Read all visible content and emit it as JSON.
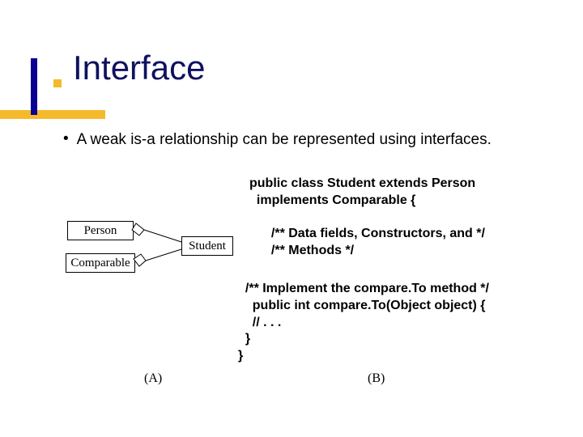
{
  "title": "Interface",
  "bullet": "A weak is-a relationship can be represented using interfaces.",
  "code_top": "public class Student extends Person\n  implements Comparable {",
  "code_mid": "  /** Data fields, Constructors, and */\n  /** Methods */",
  "code_bot": "  /** Implement the compare.To method */\n    public int compare.To(Object object) {\n    // . . .\n  }\n}",
  "uml": {
    "person": "Person",
    "comparable": "Comparable",
    "student": "Student"
  },
  "label_a": "(A)",
  "label_b": "(B)"
}
